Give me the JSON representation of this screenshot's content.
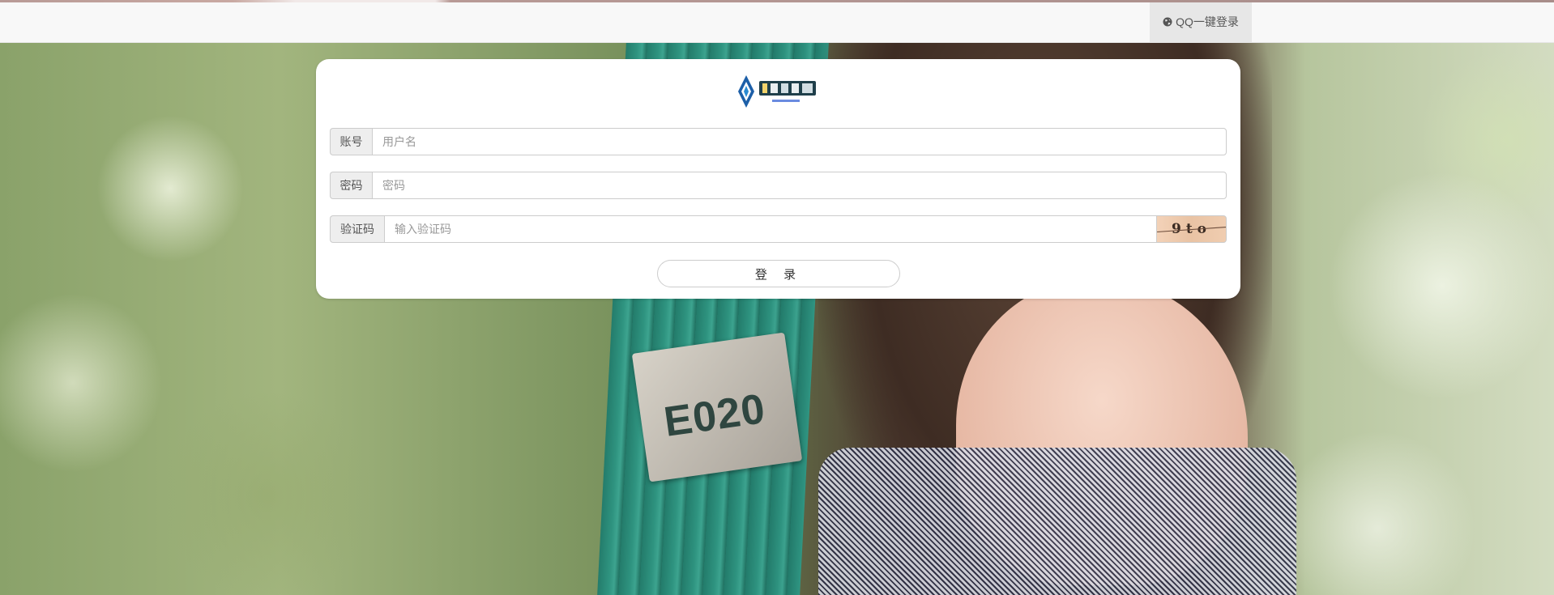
{
  "navbar": {
    "qq_login_label": "QQ一键登录",
    "icon": "globe-icon"
  },
  "background": {
    "sign_text": "E020"
  },
  "login_form": {
    "logo_icon": "site-logo-icon",
    "account": {
      "label": "账号",
      "placeholder": "用户名",
      "value": ""
    },
    "password": {
      "label": "密码",
      "placeholder": "密码",
      "value": ""
    },
    "captcha": {
      "label": "验证码",
      "placeholder": "输入验证码",
      "value": "",
      "image_text": "9to"
    },
    "submit_label": "登 录"
  },
  "colors": {
    "navbar_bg": "#f8f8f8",
    "nav_active_bg": "#e7e7e7",
    "pole_green": "#2b9482"
  }
}
